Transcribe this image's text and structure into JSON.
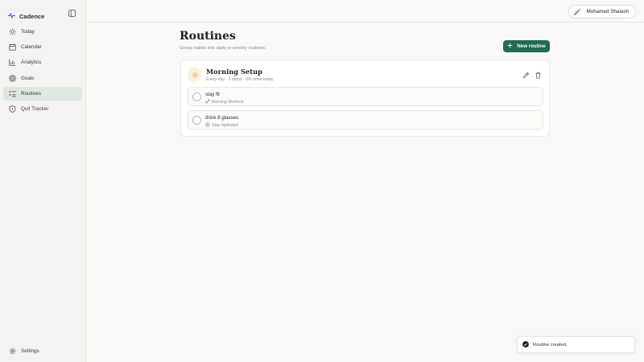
{
  "app": {
    "name": "Cadence",
    "accent": "#1f6b53",
    "icon": "pulse-icon"
  },
  "sidebar": {
    "items": [
      {
        "label": "Today",
        "icon": "sun-icon"
      },
      {
        "label": "Calendar",
        "icon": "calendar-icon"
      },
      {
        "label": "Analytics",
        "icon": "chart-icon"
      },
      {
        "label": "Goals",
        "icon": "target-icon"
      },
      {
        "label": "Routines",
        "icon": "list-check-icon",
        "active": true
      },
      {
        "label": "Quit Tracker",
        "icon": "shield-icon"
      }
    ],
    "settings_label": "Settings"
  },
  "user": {
    "name": "Mohamed Shalash"
  },
  "page": {
    "title": "Routines",
    "subtitle": "Group habits into daily or weekly routines.",
    "new_button_label": "New routine"
  },
  "routine": {
    "title": "Morning Setup",
    "meta": "Every day · 2 steps · 0% done today",
    "steps": [
      {
        "name": "stay fit",
        "goal": "Morning Workout",
        "goal_icon": "dumbbell-icon"
      },
      {
        "name": "drink 8 glasses",
        "goal": "Stay Hydrated",
        "goal_icon": "target-icon"
      }
    ]
  },
  "toast": {
    "message": "Routine created."
  }
}
